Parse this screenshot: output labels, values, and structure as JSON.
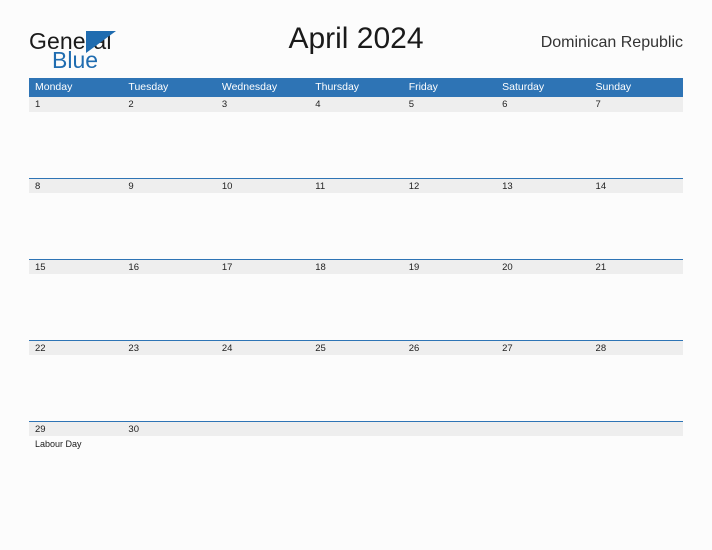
{
  "brand": {
    "name_top": "General",
    "name_bottom": "Blue",
    "accent_color": "#1f6cb0",
    "flag_icon": "triangle-flag-icon"
  },
  "header": {
    "title": "April 2024",
    "region": "Dominican Republic"
  },
  "calendar": {
    "header_bg": "#2e74b5",
    "date_strip_bg": "#eeeeee",
    "page_bg": "#fcfcfc",
    "day_names": [
      "Monday",
      "Tuesday",
      "Wednesday",
      "Thursday",
      "Friday",
      "Saturday",
      "Sunday"
    ],
    "weeks": [
      {
        "days": [
          {
            "date": "1",
            "events": []
          },
          {
            "date": "2",
            "events": []
          },
          {
            "date": "3",
            "events": []
          },
          {
            "date": "4",
            "events": []
          },
          {
            "date": "5",
            "events": []
          },
          {
            "date": "6",
            "events": []
          },
          {
            "date": "7",
            "events": []
          }
        ]
      },
      {
        "days": [
          {
            "date": "8",
            "events": []
          },
          {
            "date": "9",
            "events": []
          },
          {
            "date": "10",
            "events": []
          },
          {
            "date": "11",
            "events": []
          },
          {
            "date": "12",
            "events": []
          },
          {
            "date": "13",
            "events": []
          },
          {
            "date": "14",
            "events": []
          }
        ]
      },
      {
        "days": [
          {
            "date": "15",
            "events": []
          },
          {
            "date": "16",
            "events": []
          },
          {
            "date": "17",
            "events": []
          },
          {
            "date": "18",
            "events": []
          },
          {
            "date": "19",
            "events": []
          },
          {
            "date": "20",
            "events": []
          },
          {
            "date": "21",
            "events": []
          }
        ]
      },
      {
        "days": [
          {
            "date": "22",
            "events": []
          },
          {
            "date": "23",
            "events": []
          },
          {
            "date": "24",
            "events": []
          },
          {
            "date": "25",
            "events": []
          },
          {
            "date": "26",
            "events": []
          },
          {
            "date": "27",
            "events": []
          },
          {
            "date": "28",
            "events": []
          }
        ]
      },
      {
        "days": [
          {
            "date": "29",
            "events": [
              "Labour Day"
            ]
          },
          {
            "date": "30",
            "events": []
          },
          {
            "date": "",
            "events": []
          },
          {
            "date": "",
            "events": []
          },
          {
            "date": "",
            "events": []
          },
          {
            "date": "",
            "events": []
          },
          {
            "date": "",
            "events": []
          }
        ]
      }
    ]
  }
}
